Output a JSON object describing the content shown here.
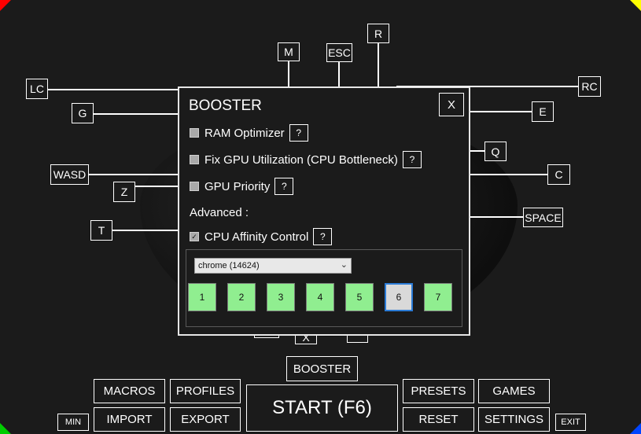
{
  "colors": {
    "corner_top_left": "#ff0000",
    "corner_top_right": "#ffff00",
    "corner_bottom_left": "#00cc00",
    "corner_bottom_right": "#0044ff",
    "core_enabled": "#90ee90",
    "core_disabled": "#d9d9d9"
  },
  "keys": {
    "m": "M",
    "esc": "ESC",
    "r": "R",
    "lc": "LC",
    "rc": "RC",
    "g": "G",
    "e": "E",
    "q": "Q",
    "wasd": "WASD",
    "z": "Z",
    "c": "C",
    "space": "SPACE",
    "t": "T",
    "x": "X"
  },
  "dialog": {
    "title": "BOOSTER",
    "close_label": "X",
    "options": [
      {
        "label": "RAM Optimizer",
        "checked": false,
        "help": "?"
      },
      {
        "label": "Fix GPU Utilization (CPU Bottleneck)",
        "checked": false,
        "help": "?"
      },
      {
        "label": "GPU Priority",
        "checked": false,
        "help": "?"
      }
    ],
    "advanced_label": "Advanced :",
    "affinity": {
      "label": "CPU Affinity Control",
      "checked": true,
      "help": "?"
    },
    "process_select": "chrome (14624)",
    "cores": [
      {
        "label": "1",
        "enabled": true
      },
      {
        "label": "2",
        "enabled": true
      },
      {
        "label": "3",
        "enabled": true
      },
      {
        "label": "4",
        "enabled": true
      },
      {
        "label": "5",
        "enabled": true
      },
      {
        "label": "6",
        "enabled": false
      },
      {
        "label": "7",
        "enabled": true
      }
    ]
  },
  "buttons": {
    "booster": "BOOSTER",
    "macros": "MACROS",
    "profiles": "PROFILES",
    "import": "IMPORT",
    "export": "EXPORT",
    "start": "START (F6)",
    "presets": "PRESETS",
    "games": "GAMES",
    "reset": "RESET",
    "settings": "SETTINGS",
    "min": "MIN",
    "exit": "EXIT"
  }
}
